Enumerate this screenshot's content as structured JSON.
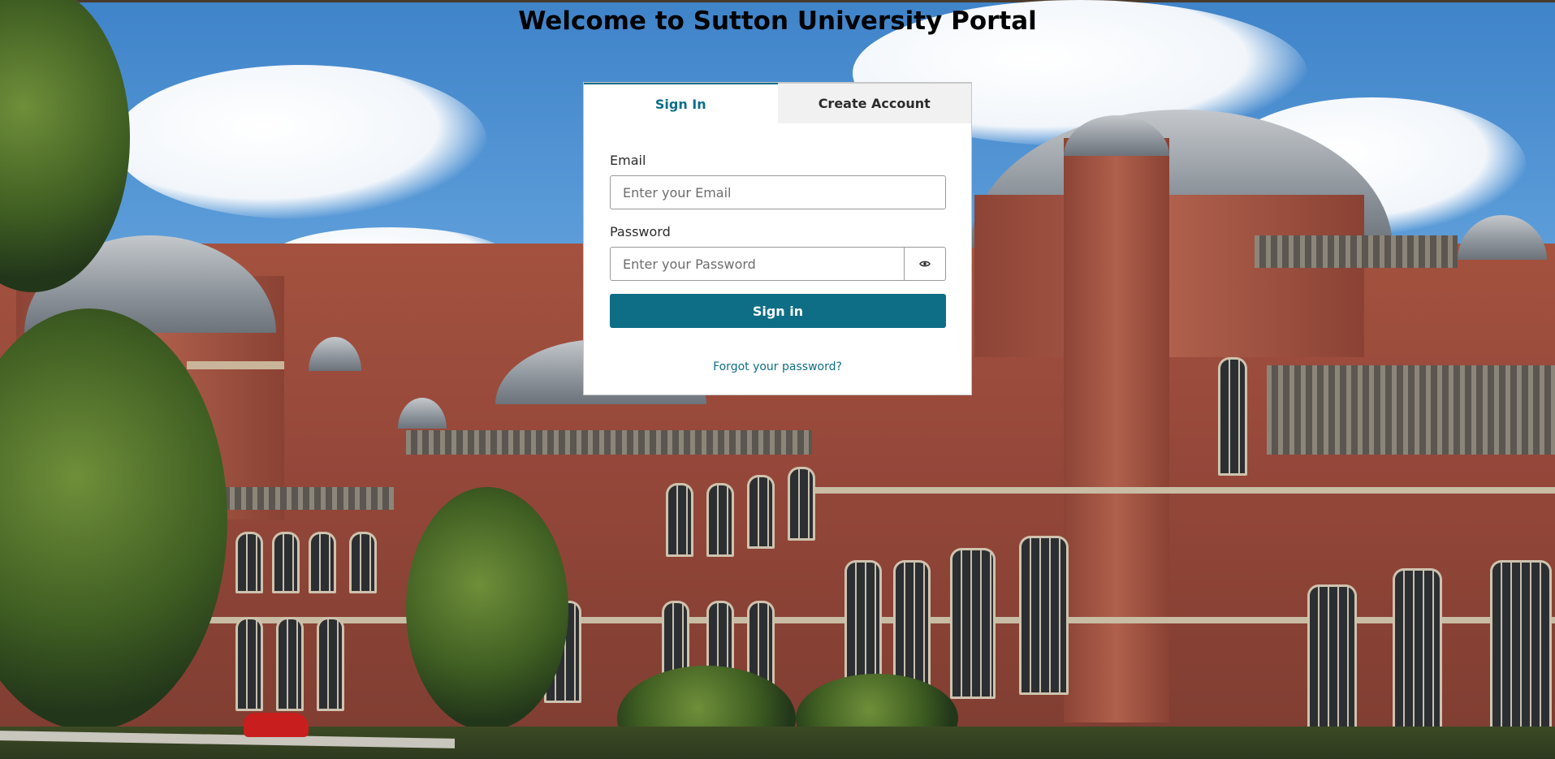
{
  "page": {
    "title": "Welcome to Sutton University Portal"
  },
  "tabs": [
    {
      "label": "Sign In",
      "active": true
    },
    {
      "label": "Create Account",
      "active": false
    }
  ],
  "form": {
    "email_label": "Email",
    "email_placeholder": "Enter your Email",
    "email_value": "",
    "password_label": "Password",
    "password_placeholder": "Enter your Password",
    "password_value": "",
    "toggle_icon": "eye-icon",
    "submit_label": "Sign in",
    "forgot_link": "Forgot your password?"
  },
  "colors": {
    "accent": "#0d6e86",
    "title_text": "#000000",
    "inactive_tab_bg": "#f1f1f1"
  },
  "background": {
    "subject": "university-campus-building-photo"
  }
}
